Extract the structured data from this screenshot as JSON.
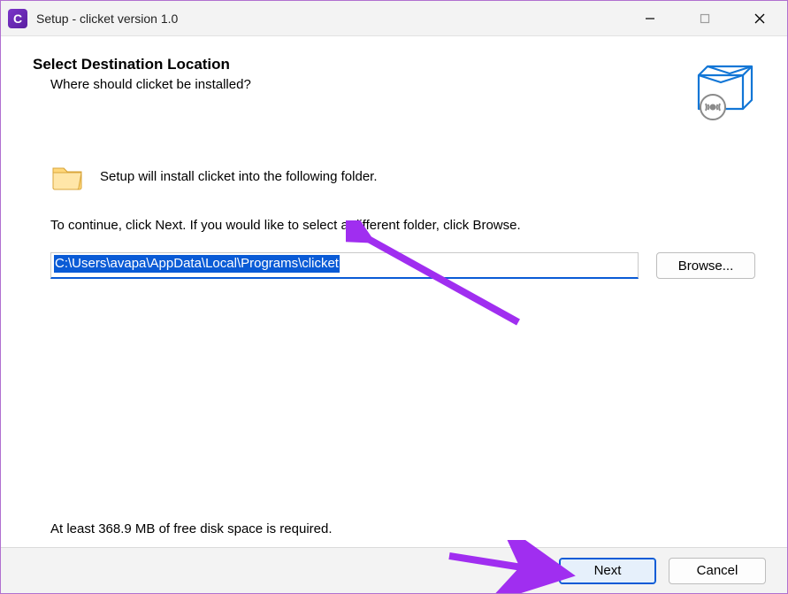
{
  "titlebar": {
    "app_icon_letter": "C",
    "title": "Setup - clicket version 1.0"
  },
  "header": {
    "heading": "Select Destination Location",
    "subheading": "Where should clicket be installed?"
  },
  "body": {
    "install_line": "Setup will install clicket into the following folder.",
    "instruction": "To continue, click Next. If you would like to select a different folder, click Browse.",
    "install_path": "C:\\Users\\avapa\\AppData\\Local\\Programs\\clicket",
    "browse_label": "Browse...",
    "disk_req": "At least 368.9 MB of free disk space is required."
  },
  "footer": {
    "next_label": "Next",
    "cancel_label": "Cancel"
  }
}
